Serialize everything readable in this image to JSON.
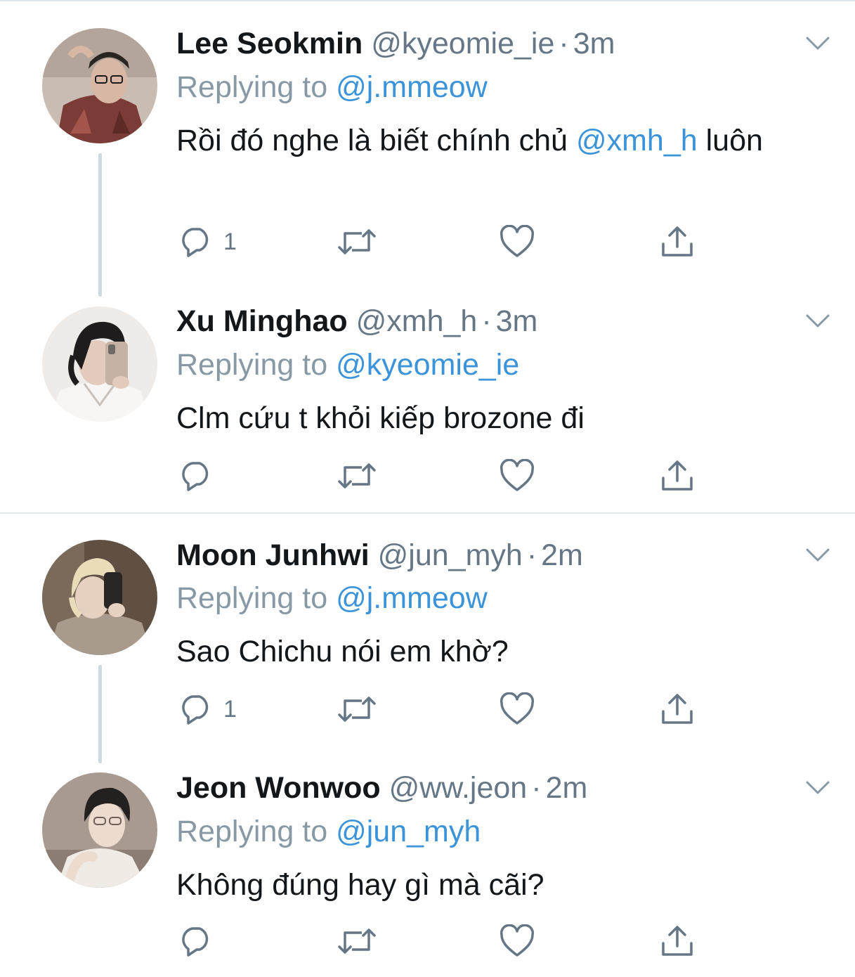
{
  "tweets": [
    {
      "name": "Lee Seokmin",
      "handle": "@kyeomie_ie",
      "separator": "·",
      "time": "3m",
      "replying_prefix": "Replying to",
      "replying_to": "@j.mmeow",
      "text_before": "Rồi đó nghe là biết chính chủ ",
      "text_mention": "@xmh_h",
      "text_after": " luôn",
      "reply_count": "1",
      "avatar_colors": [
        "#b9a89c",
        "#7b3b36",
        "#2b2522"
      ]
    },
    {
      "name": "Xu Minghao",
      "handle": "@xmh_h",
      "separator": "·",
      "time": "3m",
      "replying_prefix": "Replying to",
      "replying_to": "@kyeomie_ie",
      "text_before": "Clm cứu t khỏi kiếp brozone đi",
      "text_mention": "",
      "text_after": "",
      "reply_count": "",
      "avatar_colors": [
        "#f1efec",
        "#1e1c1c",
        "#d9cfc8"
      ]
    },
    {
      "name": "Moon Junhwi",
      "handle": "@jun_myh",
      "separator": "·",
      "time": "2m",
      "replying_prefix": "Replying to",
      "replying_to": "@j.mmeow",
      "text_before": "Sao Chichu nói em khờ?",
      "text_mention": "",
      "text_after": "",
      "reply_count": "1",
      "avatar_colors": [
        "#6b5a4b",
        "#e9dcb8",
        "#a89b8e"
      ]
    },
    {
      "name": "Jeon Wonwoo",
      "handle": "@ww.jeon",
      "separator": "·",
      "time": "2m",
      "replying_prefix": "Replying to",
      "replying_to": "@jun_myh",
      "text_before": "Không đúng hay gì mà cãi?",
      "text_mention": "",
      "text_after": "",
      "reply_count": "",
      "avatar_colors": [
        "#9a8b80",
        "#252020",
        "#ecdcd0"
      ]
    }
  ],
  "colors": {
    "name": "#14171a",
    "secondary": "#657786",
    "mention": "#3b94d9",
    "thread_line": "#cfd9de",
    "divider": "#e1e8ed"
  },
  "icons": {
    "reply": "reply-icon",
    "retweet": "retweet-icon",
    "like": "heart-icon",
    "share": "share-icon",
    "menu": "chevron-down-icon"
  }
}
